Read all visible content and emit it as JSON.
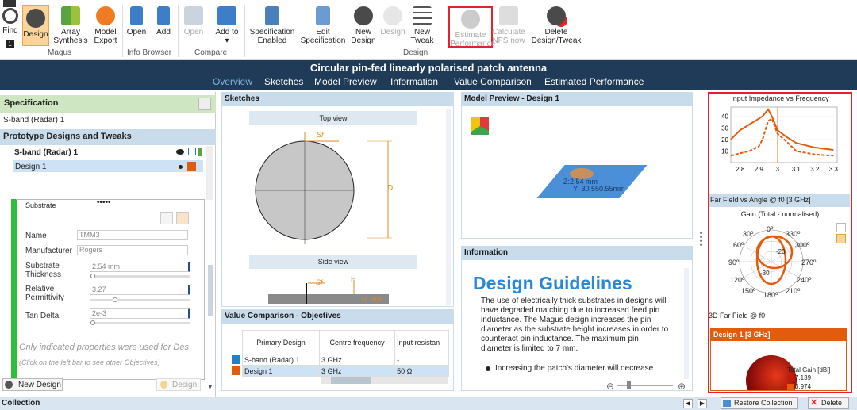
{
  "ribbon": {
    "find": "Find",
    "design": "Design",
    "array": "Array Synthesis",
    "model_export": "Model Export",
    "open": "Open",
    "add": "Add",
    "open2": "Open",
    "add_to": "Add to ▾",
    "spec_enabled": "Specification Enabled",
    "edit_spec": "Edit Specification",
    "new_design": "New Design",
    "design_dis": "Design",
    "new_tweak": "New Tweak",
    "estimate": "Estimate Performance",
    "calc_nfs": "Calculate NFS now",
    "delete": "Delete Design/Tweak",
    "groups": {
      "magus": "Magus",
      "info": "Info Browser",
      "compare": "Compare",
      "design": "Design"
    }
  },
  "app": {
    "title": "Circular pin-fed linearly polarised patch antenna"
  },
  "nav": [
    "Overview",
    "Sketches",
    "Model Preview",
    "Information",
    "Value Comparison",
    "Estimated Performance"
  ],
  "left": {
    "spec_header": "Specification",
    "spec_value": "S-band (Radar) 1",
    "proto_header": "Prototype Designs and Tweaks",
    "tree": [
      "S-band (Radar) 1",
      "Design 1"
    ],
    "substrate": "Substrate",
    "dots": "•••••",
    "fields": {
      "name_l": "Name",
      "name_v": "TMM3",
      "mfr_l": "Manufacturer",
      "mfr_v": "Rogers",
      "thk_l": "Substrate Thickness",
      "thk_v": "2.54 mm",
      "perm_l": "Relative Permittivity",
      "perm_v": "3.27",
      "tan_l": "Tan Delta",
      "tan_v": "2e-3"
    },
    "note1": "Only indicated properties were used for Des",
    "note2": "(Click on the left bar to see other Objectives)",
    "new_design_btn": "New Design",
    "design_btn": "Design"
  },
  "sketches": {
    "header": "Sketches",
    "top_view": "Top view",
    "side_view": "Side view",
    "sf": "Sf",
    "d": "D",
    "h": "H",
    "er": "εr, tanδ"
  },
  "model": {
    "header": "Model Preview  -  Design 1",
    "dims": "Z:2.54 mm",
    "dims2": "Y: 30.550.55mm"
  },
  "vc": {
    "header": "Value Comparison - Objectives",
    "cols": [
      "Primary Design",
      "Centre frequency",
      "Input resistan"
    ],
    "rows": [
      [
        "S-band (Radar) 1",
        "3 GHz",
        "-"
      ],
      [
        "Design 1",
        "3 GHz",
        "50 Ω"
      ]
    ]
  },
  "info": {
    "header": "Information",
    "title": "Design Guidelines",
    "body": "The use of electrically thick substrates in designs will have degraded matching due to increased feed pin inductance. The Magus design increases the pin diameter as the substrate height increases in order to counteract pin inductance. The maximum pin diameter is limited to 7 mm.",
    "bullet": "Increasing the patch's diameter will decrease"
  },
  "right": {
    "chart1_title": "Input Impedance vs Frequency",
    "chart2_header": "Far Field vs Angle @ f0 [3 GHz]",
    "chart2_title": "Gain (Total - normalised)",
    "polar_labels": [
      "0º",
      "30º",
      "60º",
      "90º",
      "120º",
      "150º",
      "180º",
      "210º",
      "240º",
      "270º",
      "300º",
      "330º",
      "-20",
      "-30"
    ],
    "ff3d_header": "3D Far Field @ f0",
    "ff3d_box": "Design 1 [3 GHz]",
    "ff3d_legend": "Total Gain [dBi]",
    "ff3d_v1": "7.139",
    "ff3d_v2": "3.974"
  },
  "status": {
    "collection": "Collection",
    "restore": "Restore Collection",
    "delete": "Delete"
  },
  "colors": {
    "accent": "#e35b0c",
    "nav_bg": "#1f3b57",
    "panel_head": "#c9dceb",
    "highlight": "#e5222a"
  },
  "chart_data": [
    {
      "type": "line",
      "title": "Input Impedance vs Frequency",
      "x": [
        2.75,
        2.8,
        2.85,
        2.9,
        2.92,
        2.95,
        2.97,
        3.0,
        3.05,
        3.1,
        3.2,
        3.3
      ],
      "series": [
        {
          "values": [
            20,
            28,
            33,
            38,
            40,
            46,
            40,
            28,
            22,
            17,
            13,
            11
          ]
        },
        {
          "values": [
            6,
            8,
            10,
            14,
            20,
            36,
            38,
            25,
            18,
            10,
            7,
            6
          ]
        }
      ],
      "xticks": [
        "2.8",
        "2.9",
        "3",
        "3.1",
        "3.2",
        "3.3"
      ],
      "yticks": [
        "10",
        "20",
        "30",
        "40"
      ],
      "xlim": [
        2.75,
        3.32
      ],
      "ylim": [
        0,
        48
      ]
    }
  ]
}
